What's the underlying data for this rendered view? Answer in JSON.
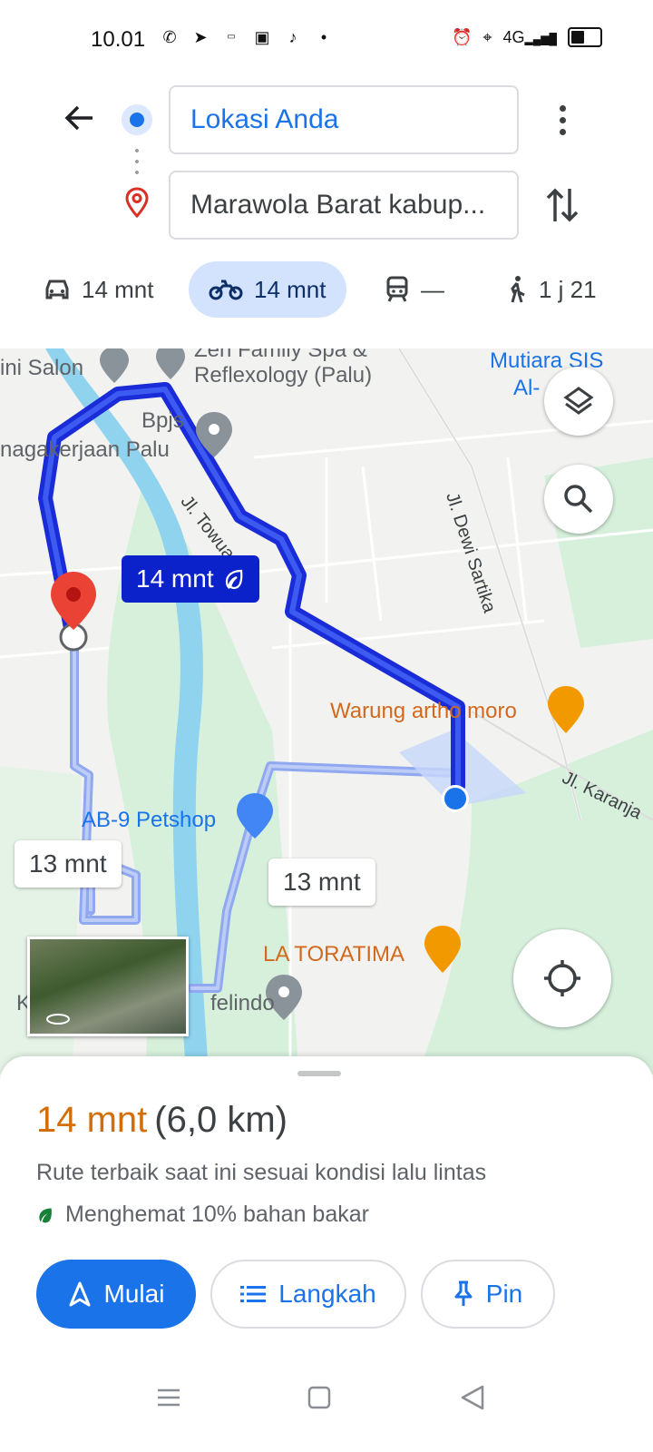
{
  "status_bar": {
    "time": "10.01",
    "icons_left": [
      "whatsapp-icon",
      "telegram-icon",
      "app-icon",
      "shopping-bag-icon",
      "tiktok-icon",
      "dot-icon"
    ],
    "icons_right": [
      "alarm-icon",
      "location-icon",
      "signal-4g-icon",
      "battery-icon"
    ],
    "network": "4G"
  },
  "directions": {
    "origin": "Lokasi Anda",
    "destination": "Marawola Barat kabup..."
  },
  "modes": [
    {
      "name": "car",
      "label": "14 mnt",
      "selected": false
    },
    {
      "name": "motorcycle",
      "label": "14 mnt",
      "selected": true
    },
    {
      "name": "transit",
      "label": "—",
      "selected": false
    },
    {
      "name": "walk",
      "label": "1 j 21",
      "selected": false
    }
  ],
  "map": {
    "pois": {
      "salon": "ini Salon",
      "spa_line1": "Zen Family Spa &",
      "spa_line2": "Reflexology (Palu)",
      "bpjs_line1": "Bpjs",
      "bpjs_line2": "nagakerjaan Palu",
      "mutiara_line1": "Mutiara SIS",
      "mutiara_line2": "Al-",
      "warung": "Warung artho moro",
      "petshop": "AB-9 Petshop",
      "toratima": "LA TORATIMA",
      "felindo": "felindo",
      "k_label": "K"
    },
    "streets": {
      "towua": "Jl. Towua",
      "dewi_sartika": "Jl. Dewi Sartika",
      "karanja": "Jl. Karanja"
    },
    "eta_main": "14 mnt",
    "eta_alt_1": "13 mnt",
    "eta_alt_2": "13 mnt",
    "route_color": "#1a2bd8",
    "alt_route_color": "#8fa8f0"
  },
  "sheet": {
    "duration": "14 mnt",
    "distance": "(6,0 km)",
    "description": "Rute terbaik saat ini sesuai kondisi lalu lintas",
    "fuel_saving": "Menghemat 10% bahan bakar",
    "buttons": {
      "start": "Mulai",
      "steps": "Langkah",
      "pin": "Pin"
    }
  },
  "colors": {
    "accent": "#1a73e8",
    "duration": "#d26e0a",
    "selected_mode_bg": "#d3e3fd"
  }
}
